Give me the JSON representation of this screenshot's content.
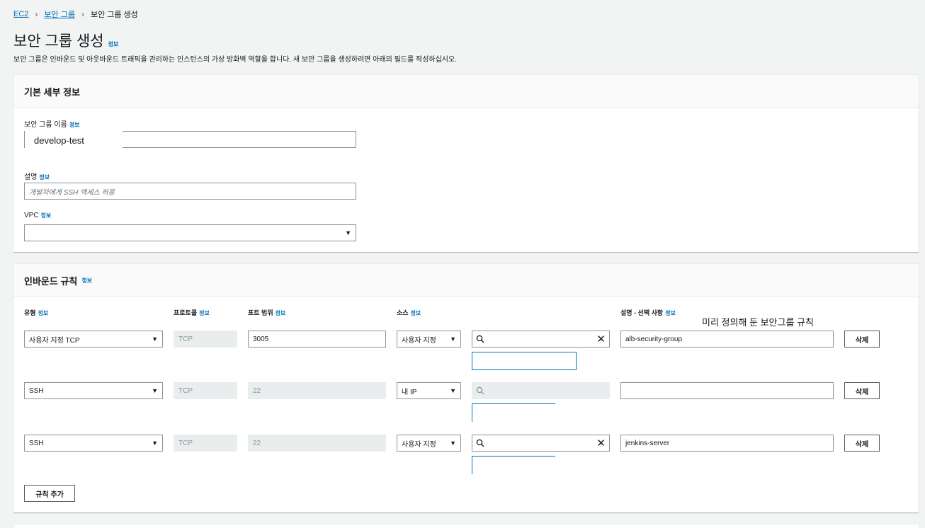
{
  "breadcrumb": {
    "item1": "EC2",
    "item2": "보안 그룹",
    "current": "보안 그룹 생성"
  },
  "page": {
    "title": "보안 그룹 생성",
    "info": "정보",
    "description": "보안 그룹은 인바운드 및 아웃바운드 트래픽을 관리하는 인스턴스의 가상 방화벽 역할을 합니다. 새 보안 그룹을 생성하려면 아래의 필드를 작성하십시오."
  },
  "basic": {
    "heading": "기본 세부 정보",
    "name_label": "보안 그룹 이름",
    "name_value": "develop-test",
    "desc_label": "설명",
    "desc_placeholder": "개발자에게 SSH 액세스 허용",
    "vpc_label": "VPC"
  },
  "inbound": {
    "heading": "인바운드 규칙",
    "columns": {
      "type": "유형",
      "protocol": "프로토콜",
      "port": "포트 범위",
      "source": "소스",
      "description": "설명 - 선택 사항"
    },
    "annotation": "미리 정의해 둔 보안그룹 규칙",
    "rules": [
      {
        "type": "사용자 지정 TCP",
        "protocol": "TCP",
        "port": "3005",
        "source": "사용자 지정",
        "description": "alb-security-group",
        "delete": "삭제"
      },
      {
        "type": "SSH",
        "protocol": "TCP",
        "port": "22",
        "source": "내 IP",
        "description": "",
        "delete": "삭제"
      },
      {
        "type": "SSH",
        "protocol": "TCP",
        "port": "22",
        "source": "사용자 지정",
        "description": "jenkins-server",
        "delete": "삭제"
      }
    ],
    "add_rule": "규칙 추가"
  },
  "icons": {
    "breadcrumb_sep": "chevron-right-icon",
    "caret": "caret-down-icon",
    "search": "search-icon",
    "clear": "close-icon"
  },
  "colors": {
    "link": "#0073bb",
    "background": "#f2f3f3",
    "panel": "#ffffff"
  }
}
